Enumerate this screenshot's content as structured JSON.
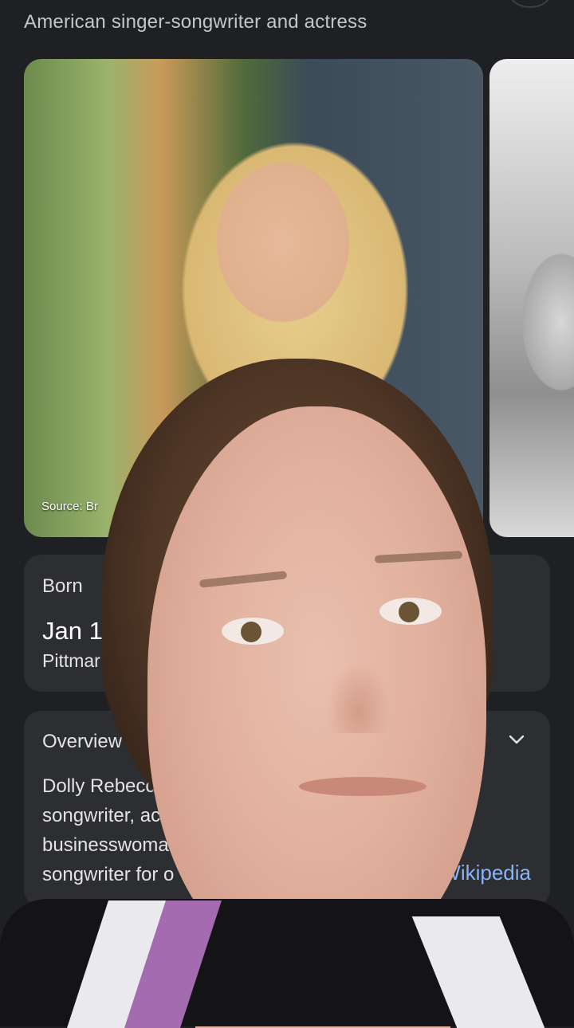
{
  "header": {
    "subtitle": "American singer-songwriter and actress"
  },
  "images": {
    "main_source": "Source: Br",
    "icon": "profile-photo"
  },
  "born": {
    "title": "Born",
    "date": "Jan 1",
    "place": "Pittmar"
  },
  "overview": {
    "title": "Overview",
    "lines": [
      "Dolly Rebecca",
      "songwriter, actre",
      "businesswoman.                    a",
      "songwriter for o"
    ],
    "link": "Wikipedia",
    "chevron_icon": "chevron-down-icon"
  },
  "colors": {
    "background": "#1f2023",
    "card": "#2d2e31",
    "link": "#8ab4f8"
  }
}
